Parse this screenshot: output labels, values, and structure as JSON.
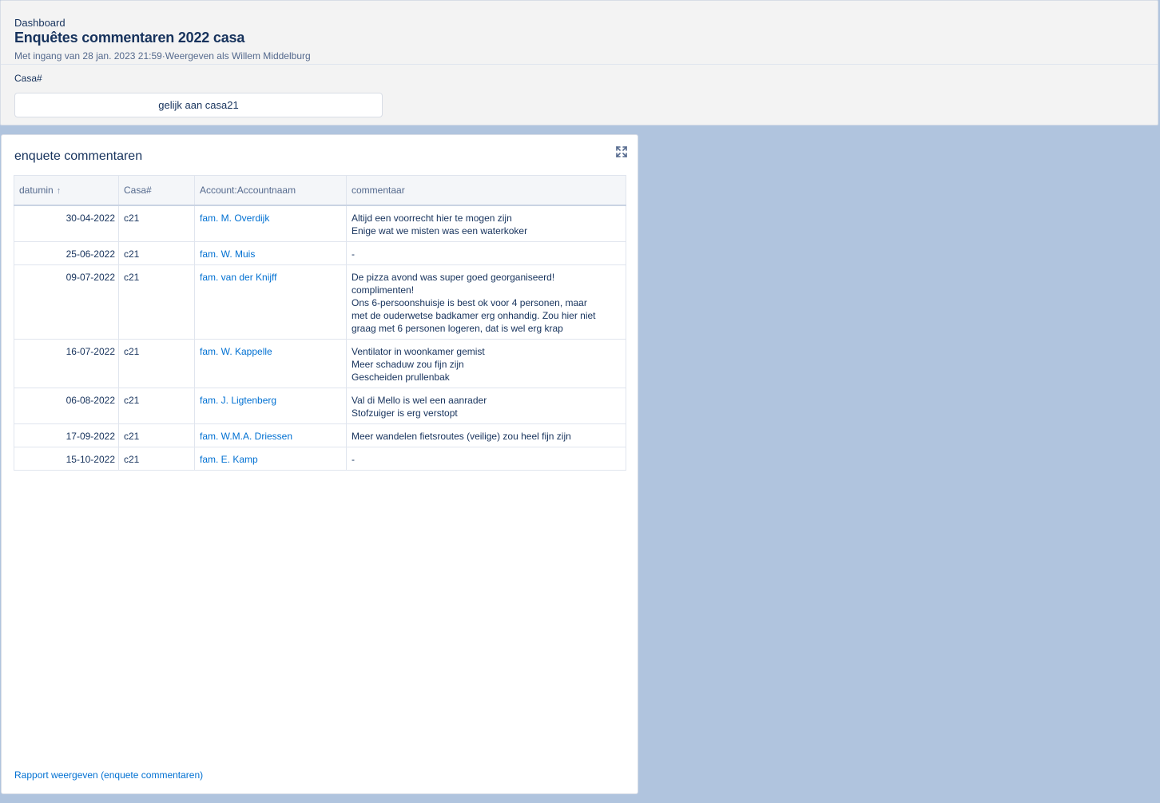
{
  "header": {
    "eyebrow": "Dashboard",
    "title": "Enquêtes commentaren 2022 casa",
    "subtitle": "Met ingang van 28 jan. 2023 21:59·Weergeven als Willem Middelburg",
    "filter_label": "Casa#",
    "filter_value": "gelijk aan casa21"
  },
  "card": {
    "title": "enquete commentaren",
    "expand_icon": "expand-icon",
    "footer_link": "Rapport weergeven (enquete commentaren)"
  },
  "table": {
    "columns": [
      "datumin",
      "Casa#",
      "Account:Accountnaam",
      "commentaar"
    ],
    "sort_icon": "↑",
    "rows": [
      {
        "date": "30-04-2022",
        "casa": "c21",
        "account": "fam. M. Overdijk",
        "comment": "Altijd een voorrecht hier te mogen zijn\nEnige wat we misten was een waterkoker"
      },
      {
        "date": "25-06-2022",
        "casa": "c21",
        "account": "fam. W. Muis",
        "comment": "-"
      },
      {
        "date": "09-07-2022",
        "casa": "c21",
        "account": "fam. van der Knijff",
        "comment": "De pizza avond was super goed georganiseerd!\ncomplimenten!\nOns 6-persoonshuisje is best ok voor 4 personen, maar\nmet de ouderwetse badkamer erg onhandig. Zou hier niet\ngraag met 6 personen logeren, dat is wel erg krap"
      },
      {
        "date": "16-07-2022",
        "casa": "c21",
        "account": "fam. W. Kappelle",
        "comment": "Ventilator in woonkamer gemist\nMeer schaduw zou fijn zijn\nGescheiden prullenbak"
      },
      {
        "date": "06-08-2022",
        "casa": "c21",
        "account": "fam. J. Ligtenberg",
        "comment": "Val di Mello is wel een aanrader\nStofzuiger is erg verstopt"
      },
      {
        "date": "17-09-2022",
        "casa": "c21",
        "account": "fam. W.M.A. Driessen",
        "comment": "Meer wandelen fietsroutes (veilige) zou heel fijn zijn"
      },
      {
        "date": "15-10-2022",
        "casa": "c21",
        "account": "fam. E. Kamp",
        "comment": "-"
      }
    ]
  },
  "colors": {
    "background": "#b0c4de",
    "link": "#0070d2",
    "text": "#16325c"
  }
}
